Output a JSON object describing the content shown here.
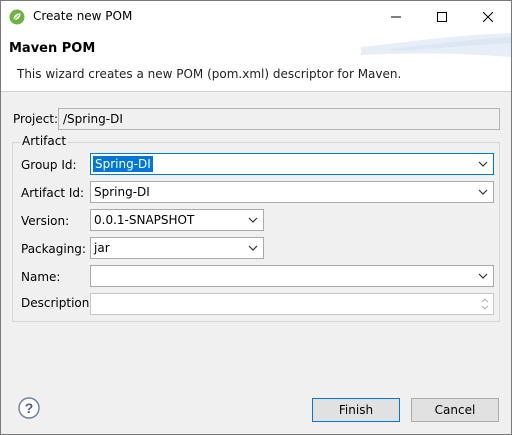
{
  "window": {
    "title": "Create new POM",
    "icons": {
      "app": "spring-leaf-icon",
      "minimize": "minimize-icon",
      "maximize": "maximize-icon",
      "close": "close-icon"
    }
  },
  "header": {
    "title": "Maven POM",
    "description": "This wizard creates a new POM (pom.xml) descriptor for Maven."
  },
  "project": {
    "label": "Project:",
    "value": "/Spring-DI"
  },
  "artifact": {
    "group_title": "Artifact",
    "group_id": {
      "label": "Group Id:",
      "value": "Spring-DI"
    },
    "artifact_id": {
      "label": "Artifact Id:",
      "value": "Spring-DI"
    },
    "version": {
      "label": "Version:",
      "value": "0.0.1-SNAPSHOT"
    },
    "packaging": {
      "label": "Packaging:",
      "value": "jar"
    },
    "name": {
      "label": "Name:",
      "value": ""
    },
    "description": {
      "label": "Description:",
      "value": ""
    }
  },
  "footer": {
    "help_icon": "help-icon",
    "finish_label": "Finish",
    "cancel_label": "Cancel"
  },
  "colors": {
    "accent": "#0078d7",
    "spring_green": "#6db33f"
  }
}
